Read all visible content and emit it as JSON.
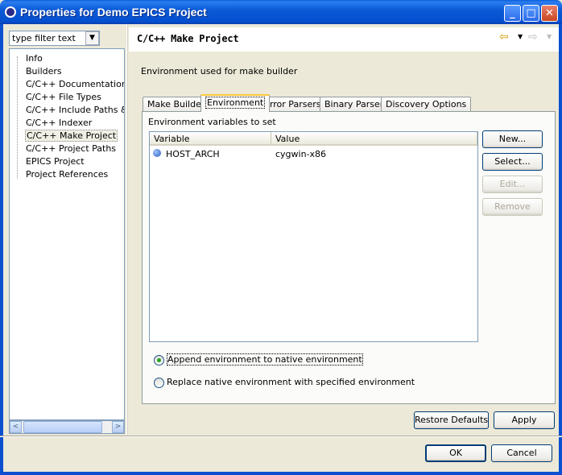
{
  "window": {
    "title": "Properties for Demo EPICS Project"
  },
  "title_buttons": {
    "minimize": "_",
    "maximize": "□",
    "close": "✕"
  },
  "filter": {
    "value": "type filter text",
    "drop_glyph": "▼"
  },
  "tree": {
    "items": [
      {
        "label": "Info"
      },
      {
        "label": "Builders"
      },
      {
        "label": "C/C++ Documentation"
      },
      {
        "label": "C/C++ File Types"
      },
      {
        "label": "C/C++ Include Paths & Sy"
      },
      {
        "label": "C/C++ Indexer"
      },
      {
        "label": "C/C++ Make Project"
      },
      {
        "label": "C/C++ Project Paths"
      },
      {
        "label": "EPICS Project"
      },
      {
        "label": "Project References"
      }
    ],
    "selected_index": 6,
    "scroll_left_glyph": "<",
    "scroll_right_glyph": ">"
  },
  "page": {
    "title": "C/C++ Make Project",
    "description": "Environment used for make builder",
    "nav_back_glyph": "⇦",
    "nav_drop_glyph": "▼",
    "nav_forward_glyph": "⇨"
  },
  "tabs": [
    {
      "label": "Make Builder"
    },
    {
      "label": "Environment"
    },
    {
      "label": "Error Parsers"
    },
    {
      "label": "Binary Parser"
    },
    {
      "label": "Discovery Options"
    }
  ],
  "active_tab": 1,
  "env": {
    "group_label": "Environment variables to set",
    "columns": {
      "variable": "Variable",
      "value": "Value"
    },
    "rows": [
      {
        "variable": "HOST_ARCH",
        "value": "cygwin-x86"
      }
    ],
    "buttons": {
      "new": "New...",
      "select": "Select...",
      "edit": "Edit...",
      "remove": "Remove"
    },
    "radio_append": "Append environment to native environment",
    "radio_replace": "Replace native environment with specified environment",
    "append_selected": true
  },
  "footer": {
    "restore_defaults": "Restore Defaults",
    "apply": "Apply",
    "ok": "OK",
    "cancel": "Cancel"
  }
}
